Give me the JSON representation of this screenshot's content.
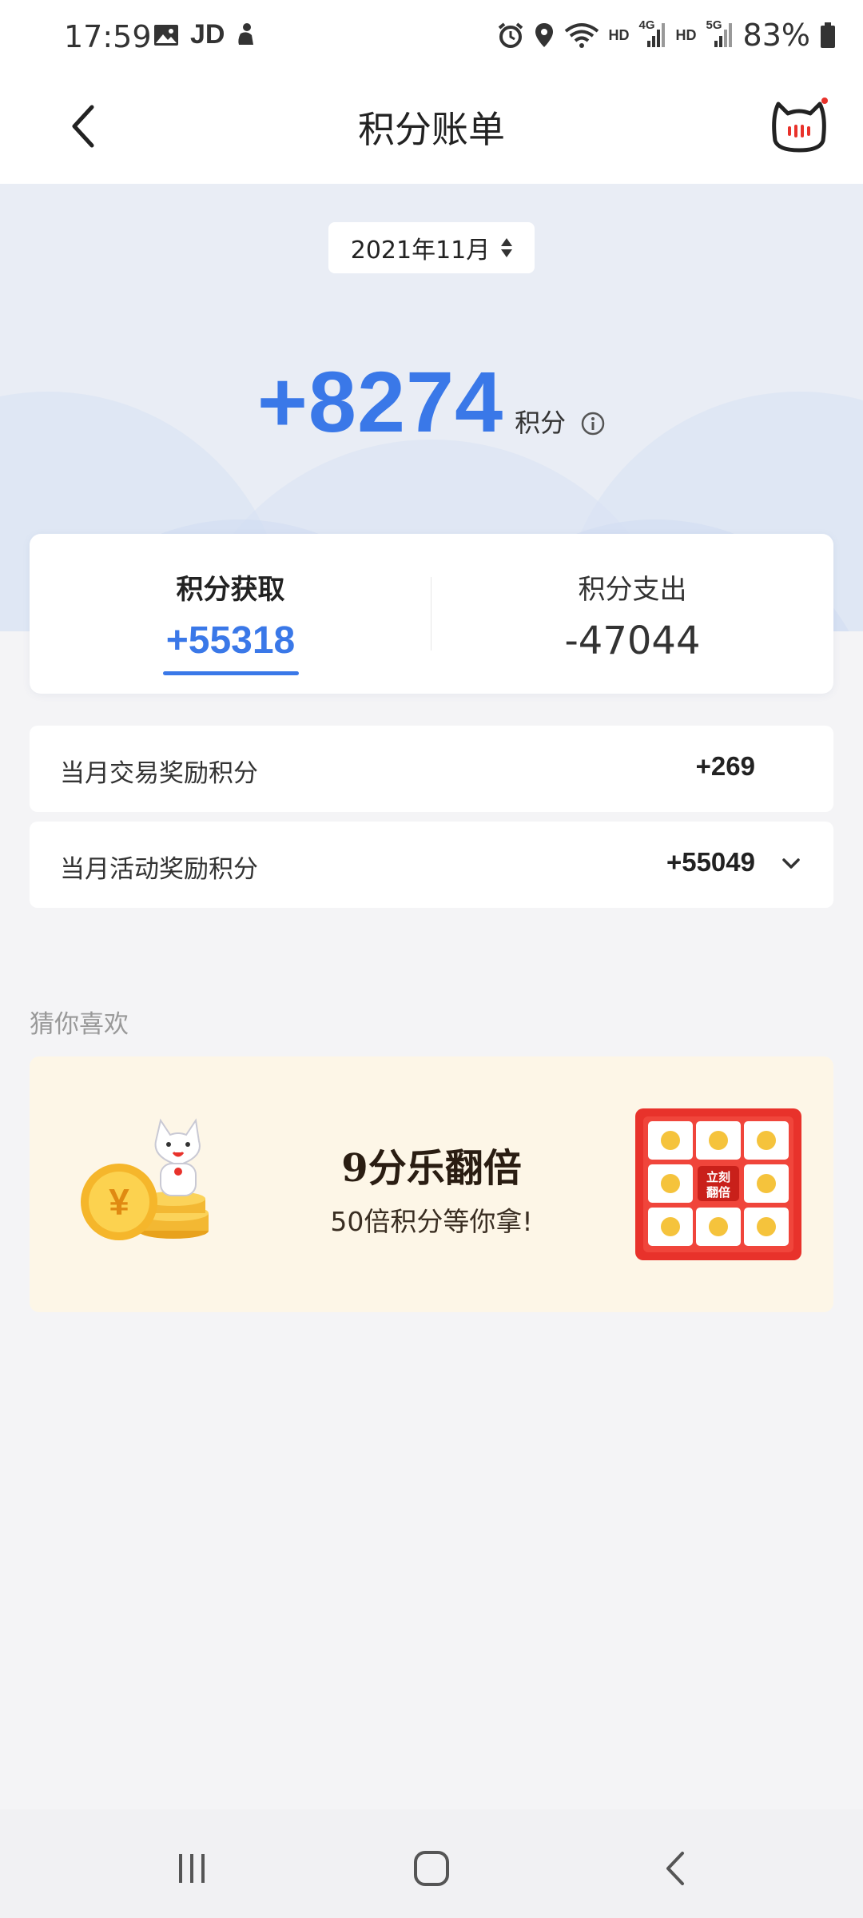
{
  "status_bar": {
    "time": "17:59",
    "app_indicator": "JD",
    "network_1": "HD",
    "network_1_gen": "4G",
    "network_2": "HD",
    "network_2_gen": "5G",
    "battery": "83%"
  },
  "nav": {
    "title": "积分账单",
    "back_icon": "chevron-left-icon",
    "mascot_icon": "cat-mascot-icon"
  },
  "hero": {
    "month": "2021年11月",
    "total": "+8274",
    "unit": "积分"
  },
  "summary": {
    "earn_label": "积分获取",
    "earn_value": "+55318",
    "spend_label": "积分支出",
    "spend_value": "-47044"
  },
  "details": [
    {
      "label": "当月交易奖励积分",
      "value": "+269"
    },
    {
      "label": "当月活动奖励积分",
      "value": "+55049"
    }
  ],
  "recommend": {
    "section_title": "猜你喜欢",
    "banner_title": "9分乐翻倍",
    "banner_subtitle": "50倍积分等你拿!",
    "badge_text_1": "立刻",
    "badge_text_2": "翻倍"
  },
  "colors": {
    "accent": "#3a78e8",
    "banner_bg": "#fdf6e7",
    "grid_red": "#e8322b"
  }
}
